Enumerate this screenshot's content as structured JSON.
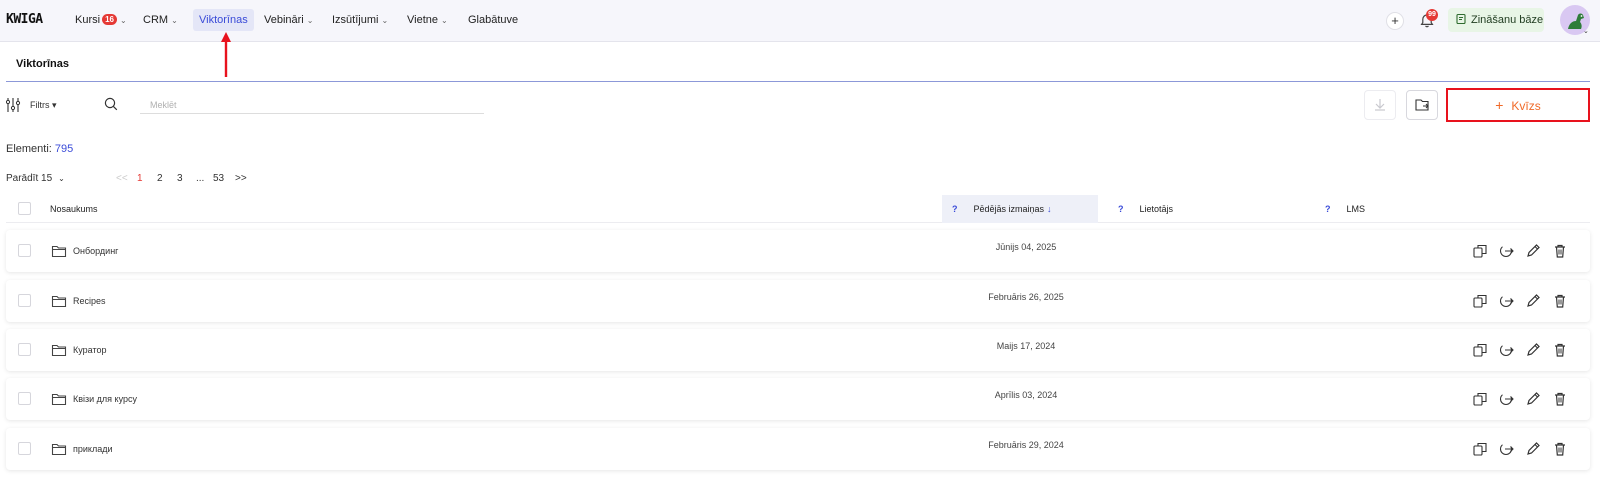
{
  "app": {
    "logo": "KWIGA"
  },
  "nav": {
    "items": [
      {
        "label": "Kursi",
        "badge": "16",
        "has_dropdown": true
      },
      {
        "label": "CRM",
        "has_dropdown": true
      },
      {
        "label": "Viktorīnas",
        "active": true
      },
      {
        "label": "Vebināri",
        "has_dropdown": true
      },
      {
        "label": "Izsūtījumi",
        "has_dropdown": true
      },
      {
        "label": "Vietne",
        "has_dropdown": true
      },
      {
        "label": "Glabātuve"
      }
    ],
    "notifications_badge": "99",
    "knowledge_base_label": "Zināšanu bāze"
  },
  "page": {
    "title": "Viktorīnas",
    "filter_label": "Filtrs",
    "search_placeholder": "Meklēt",
    "add_button_label": "Kvīzs",
    "elements_label": "Elementi:",
    "elements_count": "795",
    "show_label": "Parādīt 15"
  },
  "pagination": {
    "prev": "<<",
    "pages": [
      "1",
      "2",
      "3",
      "...",
      "53"
    ],
    "next": ">>",
    "current": "1"
  },
  "table": {
    "columns": {
      "name": "Nosaukums",
      "updated": "Pēdējās izmaiņas",
      "updated_sort": "↓",
      "user": "Lietotājs",
      "lms": "LMS",
      "help": "?"
    },
    "rows": [
      {
        "name": "Онбординг",
        "updated": "Jūnijs 04, 2025"
      },
      {
        "name": "Recipes",
        "updated": "Februāris 26, 2025"
      },
      {
        "name": "Куратор",
        "updated": "Maijs 17, 2024"
      },
      {
        "name": "Квізи для курсу",
        "updated": "Aprīlis 03, 2024"
      },
      {
        "name": "приклади",
        "updated": "Februāris 29, 2024"
      }
    ]
  },
  "colors": {
    "accent": "#3a4bd8",
    "add_button_text": "#f06a28",
    "highlight_border": "#e8121d",
    "badge": "#e53935"
  }
}
